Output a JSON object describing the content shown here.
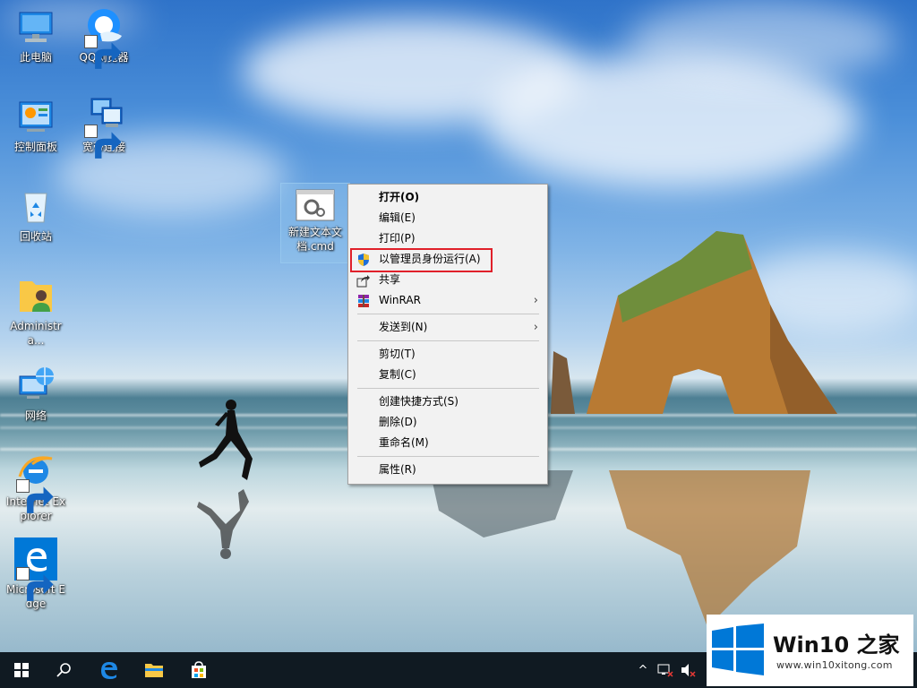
{
  "desktop": {
    "icons": [
      {
        "label": "此电脑",
        "icon": "this-pc-icon"
      },
      {
        "label": "QQ浏览器",
        "icon": "qq-browser-icon",
        "shortcut": true
      },
      {
        "label": "控制面板",
        "icon": "control-panel-icon"
      },
      {
        "label": "宽带连接",
        "icon": "broadband-connection-icon",
        "shortcut": true
      },
      {
        "label": "回收站",
        "icon": "recycle-bin-icon"
      },
      {
        "label": "Administra...",
        "icon": "user-folder-icon"
      },
      {
        "label": "网络",
        "icon": "network-icon"
      },
      {
        "label": "Internet Explorer",
        "icon": "internet-explorer-icon",
        "shortcut": true
      },
      {
        "label": "Microsoft Edge",
        "icon": "microsoft-edge-icon",
        "shortcut": true
      }
    ],
    "selected_file": {
      "label": "新建文本文档.cmd",
      "icon": "cmd-file-icon"
    }
  },
  "context_menu": {
    "items": [
      {
        "label": "打开(O)",
        "bold": true
      },
      {
        "label": "编辑(E)"
      },
      {
        "label": "打印(P)"
      },
      {
        "label": "以管理员身份运行(A)",
        "icon": "uac-shield-icon",
        "highlighted": true
      },
      {
        "label": "共享",
        "icon": "share-icon"
      },
      {
        "label": "WinRAR",
        "icon": "winrar-icon",
        "submenu": true
      },
      {
        "separator": true
      },
      {
        "label": "发送到(N)",
        "submenu": true
      },
      {
        "separator": true
      },
      {
        "label": "剪切(T)"
      },
      {
        "label": "复制(C)"
      },
      {
        "separator": true
      },
      {
        "label": "创建快捷方式(S)"
      },
      {
        "label": "删除(D)"
      },
      {
        "label": "重命名(M)"
      },
      {
        "separator": true
      },
      {
        "label": "属性(R)"
      }
    ],
    "submenu_arrow": "›",
    "highlight_color": "#e0202a"
  },
  "taskbar": {
    "buttons": [
      "start-button",
      "search-button",
      "edge-button",
      "file-explorer-button",
      "store-button"
    ],
    "tray": [
      "show-hidden-icons",
      "network-tray-icon",
      "volume-muted-icon"
    ]
  },
  "watermark": {
    "title": "Win10 之家",
    "url": "www.win10xitong.com"
  },
  "colors": {
    "accent": "#0078d7",
    "taskbar": "#101a22",
    "menu_bg": "#f2f2f2"
  }
}
